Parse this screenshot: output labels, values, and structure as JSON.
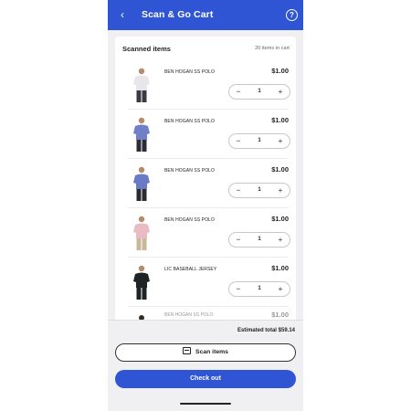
{
  "header": {
    "title": "Scan & Go Cart",
    "back_icon": "chevron-left-icon",
    "help_icon": "question-circle-icon",
    "help_glyph": "?",
    "back_glyph": "‹",
    "color": "#2f55d4"
  },
  "cart": {
    "title": "Scanned items",
    "count_text": "20 items in cart",
    "items": [
      {
        "name": "BEN HOGAN SS POLO",
        "price": "$1.00",
        "qty": "1",
        "shirt_color": "#e8e6ea",
        "pants_color": "#3a3a44"
      },
      {
        "name": "BEN HOGAN SS POLO",
        "price": "$1.00",
        "qty": "1",
        "shirt_color": "#6f7fc8",
        "pants_color": "#2c2c36"
      },
      {
        "name": "BEN HOGAN SS POLO",
        "price": "$1.00",
        "qty": "1",
        "shirt_color": "#6a7ac4",
        "pants_color": "#2a2a30"
      },
      {
        "name": "BEN HOGAN SS POLO",
        "price": "$1.00",
        "qty": "1",
        "shirt_color": "#e9bcc4",
        "pants_color": "#c9b79a"
      },
      {
        "name": "LIC BASEBALL JERSEY",
        "price": "$1.00",
        "qty": "1",
        "shirt_color": "#1e2326",
        "pants_color": "#1e2326"
      }
    ],
    "peek": {
      "name": "BEN HOGAN SS POLO",
      "price": "$1.00"
    }
  },
  "footer": {
    "total_text": "Estimated total $59.14",
    "scan_label": "Scan items",
    "scan_icon": "barcode-scan-icon",
    "checkout_label": "Check out"
  },
  "stepper": {
    "minus": "−",
    "plus": "+"
  }
}
